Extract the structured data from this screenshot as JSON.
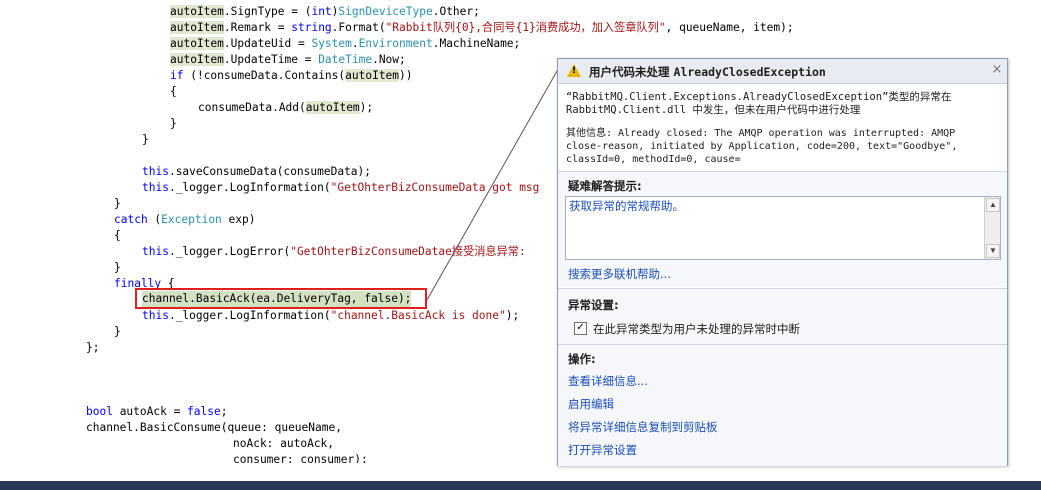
{
  "code": {
    "l01": {
      "a": "autoItem",
      "b": ".SignType = (",
      "c": "int",
      "d": ")",
      "e": "SignDeviceType",
      "f": ".Other;"
    },
    "l02": {
      "a": "autoItem",
      "b": ".Remark = ",
      "c": "string",
      "d": ".Format(",
      "e": "\"Rabbit队列{0},合同号{1}消费成功，加入签章队列\"",
      "f": ", queueName, item);"
    },
    "l03": {
      "a": "autoItem",
      "b": ".UpdateUid = ",
      "c": "System",
      "d": ".",
      "e": "Environment",
      "f": ".MachineName;"
    },
    "l04": {
      "a": "autoItem",
      "b": ".UpdateTime = ",
      "c": "DateTime",
      "d": ".Now;"
    },
    "l05": {
      "a": "if",
      "b": " (!consumeData.Contains(",
      "c": "autoItem",
      "d": "))"
    },
    "l06": "{",
    "l07": {
      "a": "consumeData.Add(",
      "b": "autoItem",
      "c": ");"
    },
    "l08": "}",
    "l09": "}",
    "l10": {
      "a": "this",
      "b": ".saveConsumeData(consumeData);"
    },
    "l11": {
      "a": "this",
      "b": "._logger.LogInformation(",
      "c": "\"GetOhterBizConsumeData got msg"
    },
    "l12": "}",
    "l13": {
      "a": "catch",
      "b": " (",
      "c": "Exception",
      "d": " exp)"
    },
    "l14": "{",
    "l15": {
      "a": "this",
      "b": "._logger.LogError(",
      "c": "\"GetOhterBizConsumeDatae接受消息异常:"
    },
    "l16": "}",
    "l17": {
      "a": "finally",
      "b": " {"
    },
    "l18": "channel.BasicAck(ea.DeliveryTag, false);",
    "l19": {
      "a": "this",
      "b": "._logger.LogInformation(",
      "c": "\"channel.BasicAck is done\"",
      "d": ");"
    },
    "l20": "}",
    "l21": "};",
    "l22": {
      "a": "bool",
      "b": " autoAck = ",
      "c": "false",
      "d": ";"
    },
    "l23": "channel.BasicConsume(queue: queueName,",
    "l24": "noAck: autoAck,",
    "l25": "consumer: consumer);"
  },
  "exception_popup": {
    "title_prefix": "用户代码未处理 ",
    "title_exception": "AlreadyClosedException",
    "close_icon": "close-icon",
    "message_line1": "“RabbitMQ.Client.Exceptions.AlreadyClosedException”类型的异常在",
    "message_line2": "RabbitMQ.Client.dll 中发生，但未在用户代码中进行处理",
    "info_line1": "其他信息: Already closed: The AMQP operation was interrupted: AMQP",
    "info_line2": "close-reason, initiated by Application, code=200, text=\"Goodbye\",",
    "info_line3": "classId=0, methodId=0, cause=",
    "troubleshoot_heading": "疑难解答提示:",
    "troubleshoot_tip": "获取异常的常规帮助。",
    "search_online": "搜索更多联机帮助...",
    "settings_heading": "异常设置:",
    "break_checkbox_label": "在此异常类型为用户未处理的异常时中断",
    "break_checkbox_checked": true,
    "actions_heading": "操作:",
    "actions": [
      "查看详细信息...",
      "启用编辑",
      "将异常详细信息复制到剪贴板",
      "打开异常设置"
    ]
  },
  "colors": {
    "keyword": "#0000ff",
    "type": "#2b91af",
    "string": "#a31515",
    "highlight_box": "#e0201c",
    "status_band": "#293955"
  }
}
